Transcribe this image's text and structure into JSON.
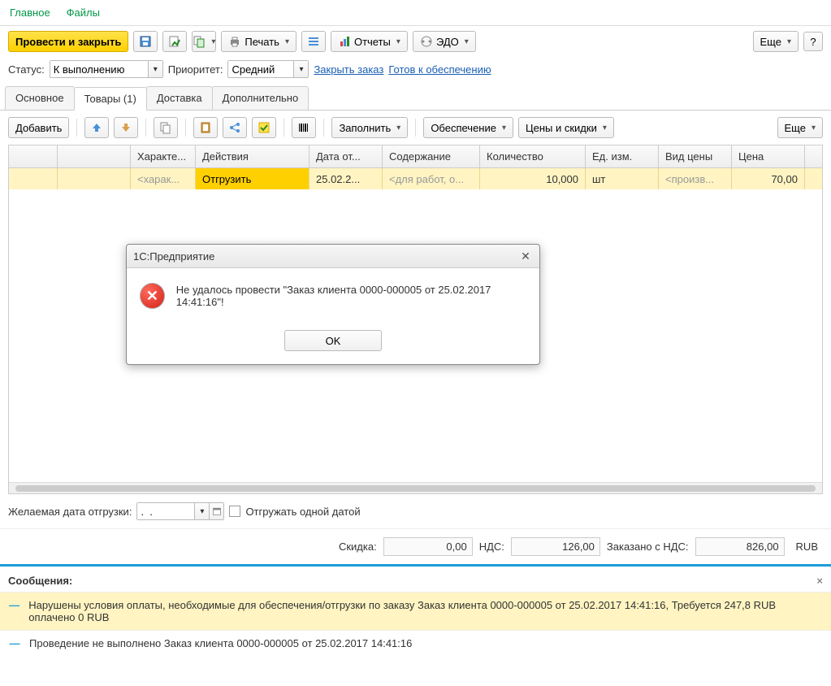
{
  "top_tabs": {
    "main": "Главное",
    "files": "Файлы"
  },
  "toolbar": {
    "post_close": "Провести и закрыть",
    "save_icon": "save-icon",
    "post_icon": "post-icon",
    "based_on_icon": "create-based-on-icon",
    "printer_icon": "printer-icon",
    "print_label": "Печать",
    "list_icon": "list-icon",
    "reports_icon": "reports-icon",
    "reports_label": "Отчеты",
    "edo_icon": "edo-icon",
    "edo_label": "ЭДО",
    "more": "Еще",
    "help": "?"
  },
  "status_row": {
    "status_label": "Статус:",
    "status_value": "К выполнению",
    "priority_label": "Приоритет:",
    "priority_value": "Средний",
    "close_order_link": "Закрыть заказ",
    "ready_link": "Готов к обеспечению"
  },
  "tabs2": {
    "main": "Основное",
    "goods": "Товары (1)",
    "delivery": "Доставка",
    "additional": "Дополнительно"
  },
  "goods_toolbar": {
    "add": "Добавить",
    "fill": "Заполнить",
    "supply": "Обеспечение",
    "prices": "Цены и скидки",
    "more": "Еще"
  },
  "grid": {
    "headers": {
      "n": "",
      "nomenclature": "",
      "characteristic": "Характе...",
      "actions": "Действия",
      "ship_date": "Дата от...",
      "content": "Содержание",
      "qty": "Количество",
      "unit": "Ед. изм.",
      "price_type": "Вид цены",
      "price": "Цена"
    },
    "rows": [
      {
        "n": "",
        "nomenclature": "",
        "characteristic": "<харак...",
        "actions": "Отгрузить",
        "ship_date": "25.02.2...",
        "content": "<для работ, о...",
        "qty": "10,000",
        "unit": "шт",
        "price_type": "<произв...",
        "price": "70,00"
      }
    ]
  },
  "ship": {
    "label": "Желаемая дата отгрузки:",
    "date_value": ".  .",
    "ship_one_date": "Отгружать одной датой"
  },
  "totals": {
    "discount_label": "Скидка:",
    "discount_value": "0,00",
    "vat_label": "НДС:",
    "vat_value": "126,00",
    "ordered_label": "Заказано с НДС:",
    "ordered_value": "826,00",
    "currency": "RUB"
  },
  "messages": {
    "title": "Сообщения:",
    "close": "×",
    "items": [
      {
        "type": "warn",
        "text": "Нарушены условия оплаты, необходимые для обеспечения/отгрузки по заказу Заказ клиента 0000-000005 от 25.02.2017 14:41:16, Требуется 247,8 RUB оплачено 0 RUB"
      },
      {
        "type": "info",
        "text": "Проведение не выполнено Заказ клиента 0000-000005 от 25.02.2017 14:41:16"
      }
    ]
  },
  "modal": {
    "title": "1С:Предприятие",
    "message": "Не удалось провести \"Заказ клиента 0000-000005 от 25.02.2017 14:41:16\"!",
    "ok": "OK"
  }
}
